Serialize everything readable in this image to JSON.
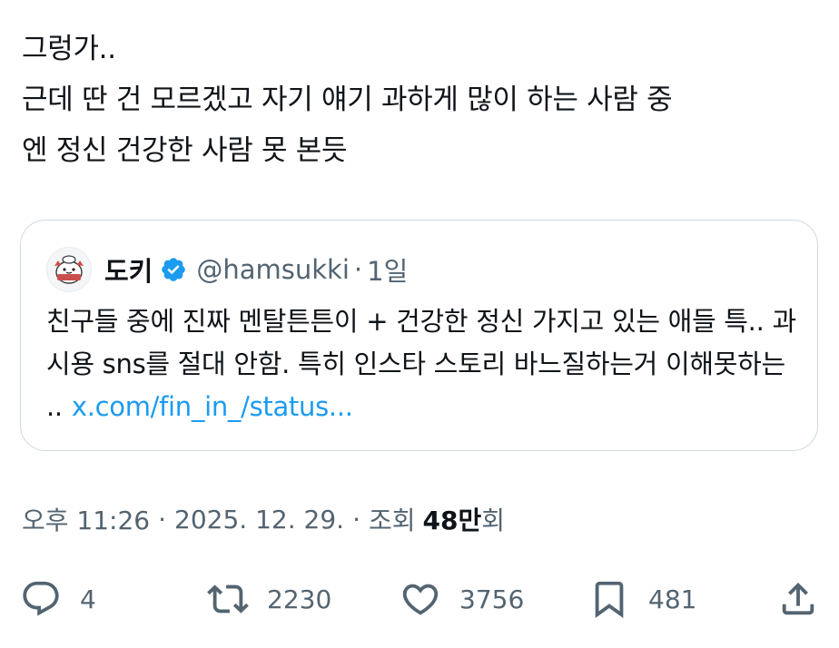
{
  "tweet": {
    "text": "그렁가..\n근데 딴 건 모르겠고 자기 얘기 과하게 많이 하는 사람 중\n엔 정신 건강한 사람 못 본듯"
  },
  "quote": {
    "name": "도키",
    "handle": "@hamsukki",
    "separator": "·",
    "time": "1일",
    "body": "친구들 중에 진짜 멘탈튼튼이 + 건강한 정신 가지고 있는 애들 특.. 과시용 sns를 절대 안함. 특히 인스타 스토리 바느질하는거 이해못하는 ..",
    "link": "x.com/fin_in_/status..."
  },
  "meta": {
    "time": "오후 11:26",
    "date": "2025. 12. 29.",
    "dot": "·",
    "views_label": "조회",
    "views_count": "48만",
    "views_suffix": "회"
  },
  "actions": {
    "replies": "4",
    "reposts": "2230",
    "likes": "3756",
    "bookmarks": "481"
  },
  "icons": {
    "reply": "reply-icon",
    "repost": "repost-icon",
    "like": "heart-icon",
    "bookmark": "bookmark-icon",
    "share": "share-icon",
    "verified": "verified-badge-icon"
  },
  "colors": {
    "text": "#0f1419",
    "secondary": "#536471",
    "link": "#1d9bf0",
    "border": "#cfd9de"
  }
}
